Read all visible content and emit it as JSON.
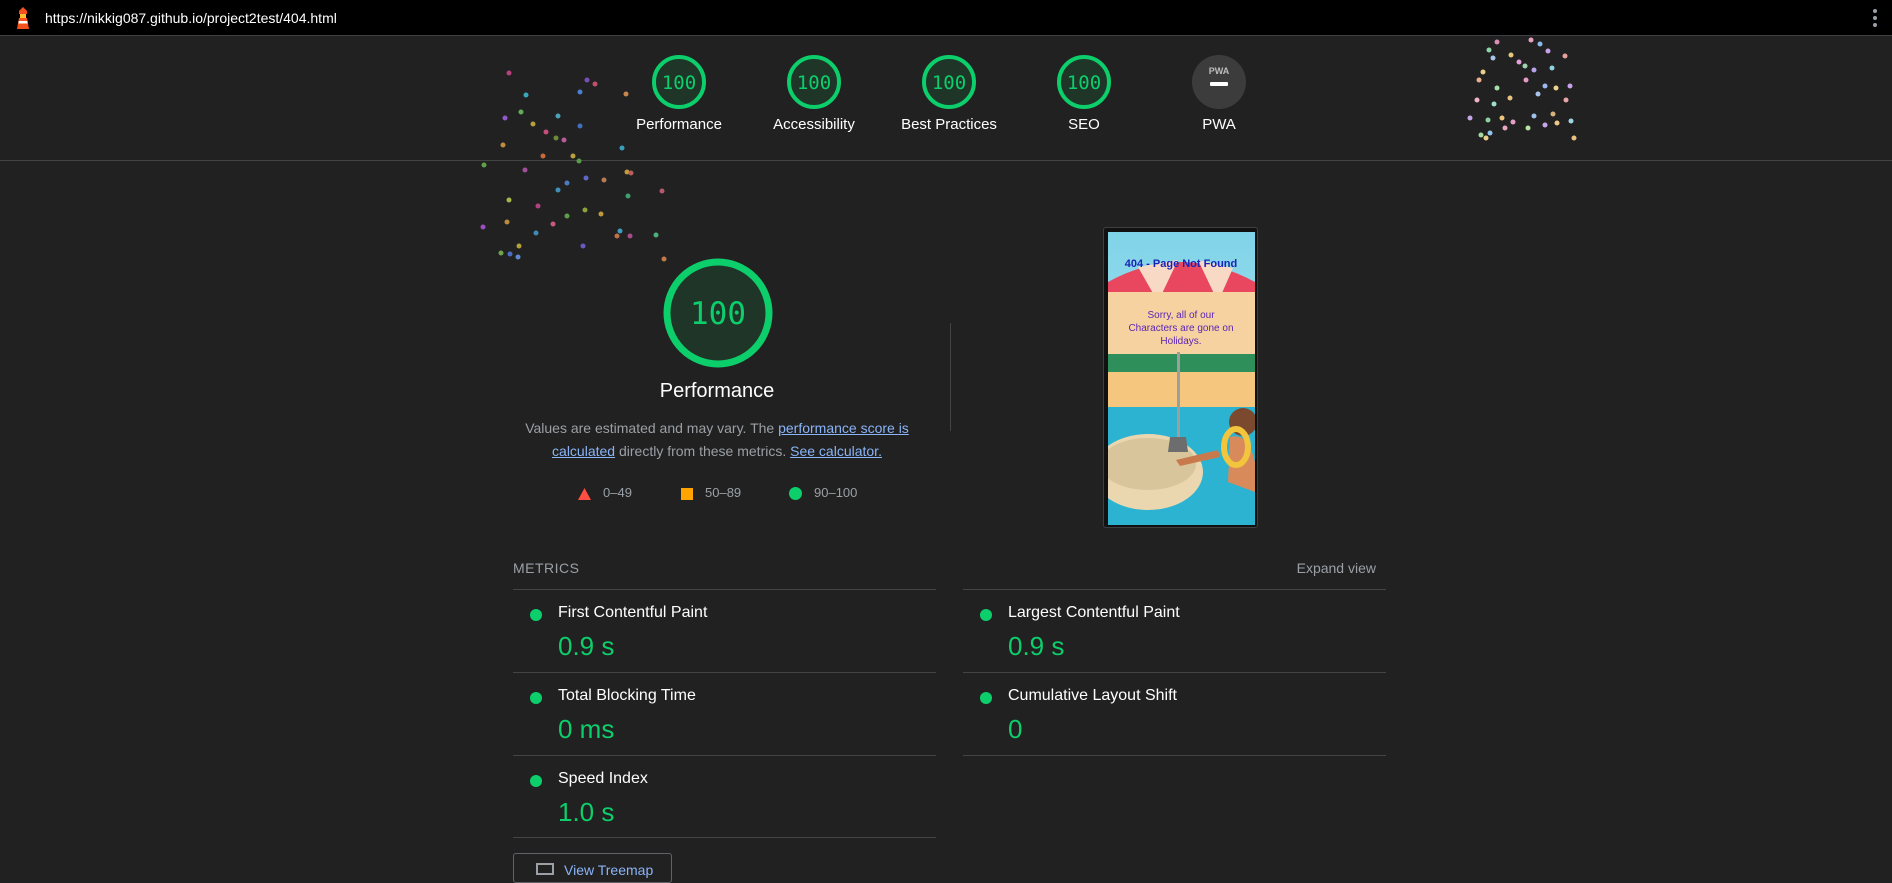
{
  "address_bar": {
    "url": "https://nikkig087.github.io/project2test/404.html"
  },
  "categories": [
    {
      "label": "Performance",
      "score": "100"
    },
    {
      "label": "Accessibility",
      "score": "100"
    },
    {
      "label": "Best Practices",
      "score": "100"
    },
    {
      "label": "SEO",
      "score": "100"
    },
    {
      "label": "PWA",
      "score": "PWA"
    }
  ],
  "performance": {
    "score": "100",
    "title": "Performance",
    "desc_prefix": "Values are estimated and may vary. The ",
    "desc_link1": "performance score is calculated",
    "desc_middle": " directly from these metrics. ",
    "desc_link2": "See calculator."
  },
  "legend": [
    {
      "range": "0–49",
      "icon": "triangle-icon",
      "color": "#ff4e42"
    },
    {
      "range": "50–89",
      "icon": "square-icon",
      "color": "#ffa400"
    },
    {
      "range": "90–100",
      "icon": "circle-icon",
      "color": "#0cce6b"
    }
  ],
  "screenshot": {
    "heading": "404 - Page Not Found",
    "message_line1": "Sorry, all of our",
    "message_line2": "Characters are gone on",
    "message_line3": "Holidays."
  },
  "metrics": {
    "header": "METRICS",
    "expand_label": "Expand view",
    "items": [
      {
        "title": "First Contentful Paint",
        "value": "0.9 s"
      },
      {
        "title": "Largest Contentful Paint",
        "value": "0.9 s"
      },
      {
        "title": "Total Blocking Time",
        "value": "0 ms"
      },
      {
        "title": "Cumulative Layout Shift",
        "value": "0"
      },
      {
        "title": "Speed Index",
        "value": "1.0 s"
      }
    ]
  },
  "treemap": {
    "label": "View Treemap"
  },
  "colors": {
    "pass": "#0cce6b",
    "background": "#212121",
    "link": "#8ab4f8"
  }
}
